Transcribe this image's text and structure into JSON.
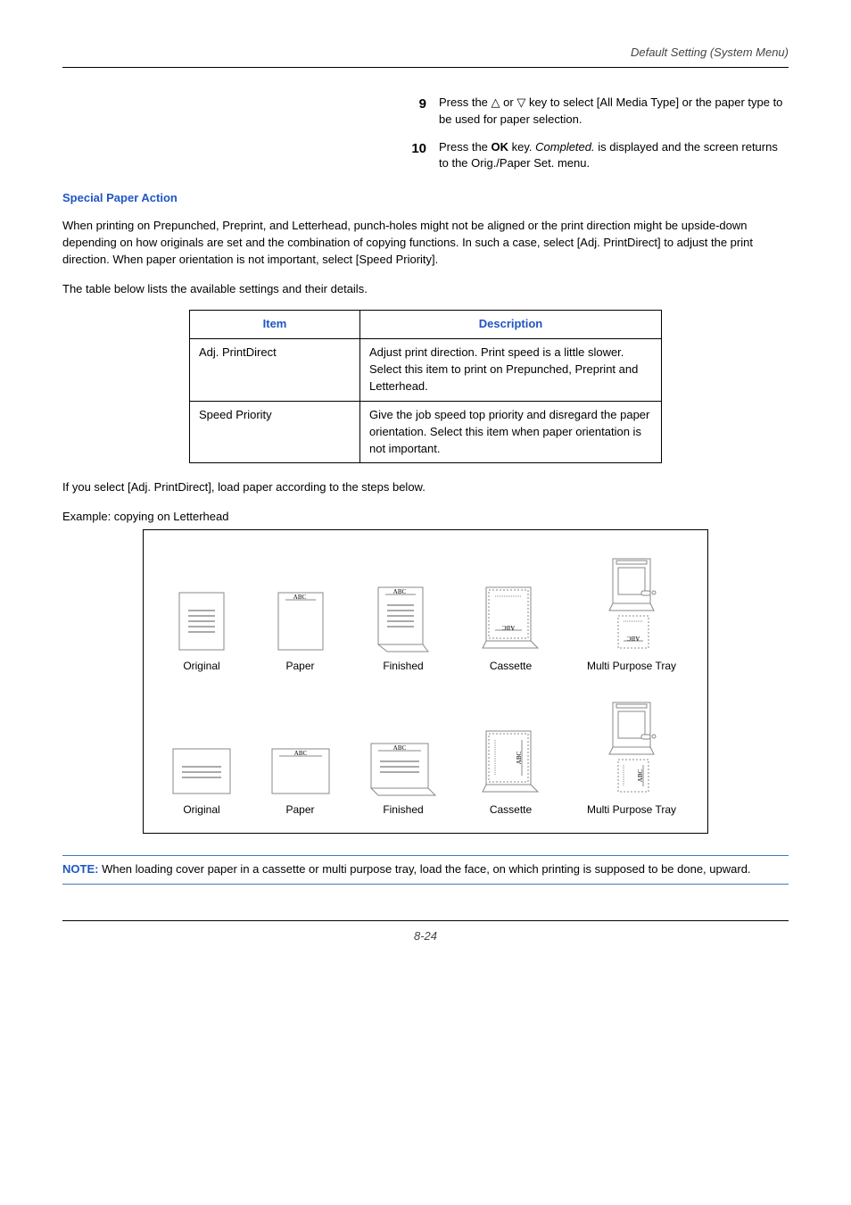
{
  "header": {
    "running": "Default Setting (System Menu)"
  },
  "steps": {
    "s9": {
      "num": "9",
      "text_a": "Press the ",
      "text_b": " or ",
      "text_c": " key to select [All Media Type] or the paper type to be used for paper selection."
    },
    "s10": {
      "num": "10",
      "text_a": "Press the ",
      "bold": "OK",
      "text_b": " key. ",
      "ital": "Completed.",
      "text_c": " is displayed and the screen returns to the Orig./Paper Set. menu."
    }
  },
  "section_title": "Special Paper Action",
  "para1": "When printing on Prepunched, Preprint, and Letterhead, punch-holes might not be aligned or the print direction might be upside-down depending on how originals are set and the combination of copying functions. In such a case, select [Adj. PrintDirect] to adjust the print direction. When paper orientation is not important, select [Speed Priority].",
  "para2": "The table below lists the available settings and their details.",
  "table": {
    "hdr_item": "Item",
    "hdr_desc": "Description",
    "r1_item": "Adj. PrintDirect",
    "r1_desc": "Adjust print direction. Print speed is a little slower. Select this item to print on Prepunched, Preprint and Letterhead.",
    "r2_item": "Speed Priority",
    "r2_desc": "Give the job speed top priority and disregard the paper orientation. Select this item when paper orientation is not important."
  },
  "para3": "If you select [Adj. PrintDirect], load paper according to the steps below.",
  "example_label": "Example: copying on Letterhead",
  "captions": {
    "c1": "Original",
    "c2": "Paper",
    "c3": "Finished",
    "c4": "Cassette",
    "c5": "Multi Purpose Tray"
  },
  "note": {
    "label": "NOTE:",
    "text": " When loading cover paper in a cassette or multi purpose tray, load the face, on which printing is supposed to be done, upward."
  },
  "footer": "8-24",
  "icons": {
    "triangle_up": "△",
    "triangle_down": "▽"
  }
}
